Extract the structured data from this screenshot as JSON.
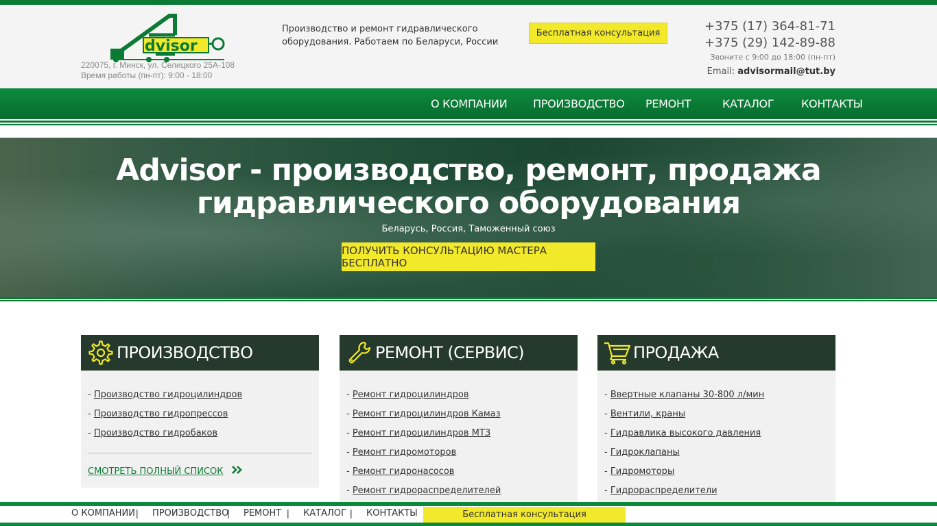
{
  "header": {
    "logo_text": "dvisor",
    "logo_letter": "A",
    "address": "220075, г. Минск, ул. Селицкого 25А-108",
    "work_hours": "Время работы (пн-пт): 9:00 - 18:00",
    "tagline": "Производство и ремонт гидравлического оборудования. Работаем по Беларуси, России",
    "consult_button": "Бесплатная консультация",
    "phone1": "+375 (17) 364-81-71",
    "phone2": "+375 (29) 142-89-88",
    "call_hours": "Звоните с 9:00 до 18:00 (пн-пт)",
    "email_label": "Email:",
    "email": "advisormail@tut.by"
  },
  "nav": {
    "items": [
      "О КОМПАНИИ",
      "ПРОИЗВОДСТВО",
      "РЕМОНТ",
      "КАТАЛОГ",
      "КОНТАКТЫ"
    ]
  },
  "hero": {
    "title_line1": "Advisor - производство, ремонт, продажа",
    "title_line2": "гидравлического оборудования",
    "subtitle": "Беларусь, Россия, Таможенный союз",
    "button": "ПОЛУЧИТЬ КОНСУЛЬТАЦИЮ МАСТЕРА БЕСПЛАТНО"
  },
  "cards": [
    {
      "title": "ПРОИЗВОДСТВО",
      "icon": "gear-icon",
      "links": [
        "Производство гидроцилиндров",
        "Производство гидропрессов",
        "Производство гидробаков"
      ],
      "more": "СМОТРЕТЬ ПОЛНЫЙ СПИСОК"
    },
    {
      "title": "РЕМОНТ (СЕРВИС)",
      "icon": "wrench-icon",
      "links": [
        "Ремонт гидроцилиндров",
        "Ремонт гидроцилиндров Камаз",
        "Ремонт гидроцилиндров МТЗ",
        "Ремонт гидромоторов",
        "Ремонт гидронасосов",
        "Ремонт гидрораспределителей"
      ]
    },
    {
      "title": "ПРОДАЖА",
      "icon": "cart-icon",
      "links": [
        "Ввертные клапаны 30-800 л/мин",
        "Вентили, краны",
        "Гидравлика высокого давления",
        "Гидроклапаны",
        "Гидромоторы",
        "Гидрораспределители"
      ]
    }
  ],
  "footer": {
    "items": [
      "О КОМПАНИИ",
      "ПРОИЗВОДСТВО",
      "РЕМОНТ",
      "КАТАЛОГ",
      "КОНТАКТЫ"
    ],
    "separator": "|",
    "consult_button": "Бесплатная консультация"
  },
  "colors": {
    "brand_green": "#0a7a34",
    "accent_yellow": "#f2e92a",
    "card_header": "#25392c"
  }
}
